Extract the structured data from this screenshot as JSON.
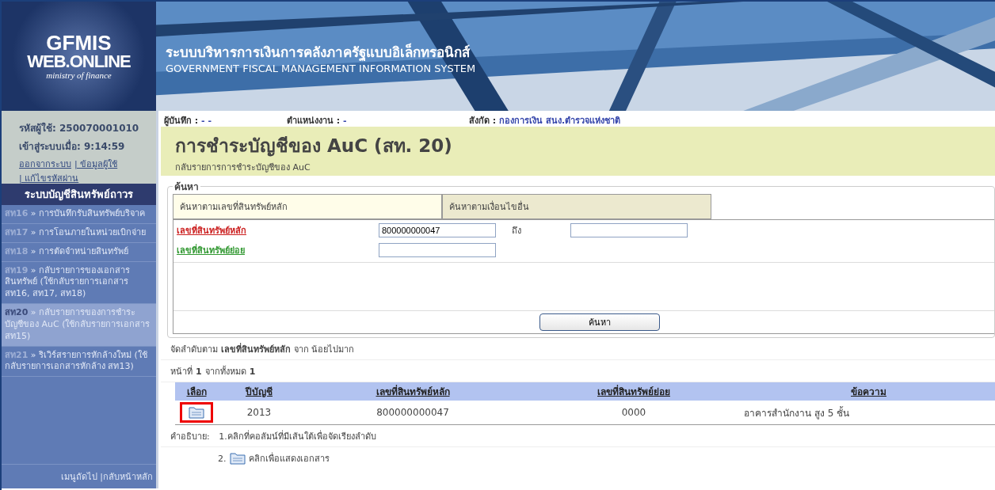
{
  "logo": {
    "line_1": "GFMIS",
    "line_2": "WEB.ONLINE",
    "line_3": "ministry of finance"
  },
  "banner": {
    "title_th": "ระบบบริหารการเงินการคลังภาครัฐแบบอิเล็กทรอนิกส์",
    "title_en": "GOVERNMENT FISCAL MANAGEMENT INFORMATION SYSTEM"
  },
  "user": {
    "id_label": "รหัสผู้ใช้:",
    "id_value": "250070001010",
    "login_label": "เข้าสู่ระบบเมื่อ:",
    "login_value": "9:14:59",
    "links": [
      "ออกจากระบบ",
      "| ข้อมูลผู้ใช้",
      "| แก้ไขรหัสผ่าน"
    ]
  },
  "sidebar": {
    "title": "ระบบบัญชีสินทรัพย์ถาวร",
    "items": [
      {
        "code": "สท16",
        "text": "» การบันทึกรับสินทรัพย์บริจาค",
        "selected": false
      },
      {
        "code": "สท17",
        "text": "» การโอนภายในหน่วยเบิกจ่าย",
        "selected": false
      },
      {
        "code": "สท18",
        "text": "» การตัดจำหน่ายสินทรัพย์",
        "selected": false
      },
      {
        "code": "สท19",
        "text": "» กลับรายการของเอกสารสินทรัพย์ (ใช้กลับรายการเอกสาร สท16, สท17, สท18)",
        "selected": false
      },
      {
        "code": "สท20",
        "text": "» กลับรายการของการชำระบัญชีของ AuC (ใช้กลับรายการเอกสาร สท15)",
        "selected": true
      },
      {
        "code": "สท21",
        "text": "» ริเวิร์สรายการหักล้างใหม่ (ใช้กลับรายการเอกสารหักล้าง สท13)",
        "selected": false
      }
    ],
    "footer": "เมนูถัดไป |กลับหน้าหลัก"
  },
  "info": [
    {
      "label": "ผู้บันทึก :",
      "value": "- -"
    },
    {
      "label": "ตำแหน่งงาน :",
      "value": "-"
    },
    {
      "label": "สังกัด :",
      "value": "กองการเงิน สนง.ตำรวจแห่งชาติ"
    }
  ],
  "page": {
    "title": "การชำระบัญชีของ AuC (สท. 20)",
    "subtitle": "กลับรายการการชำระบัญชีของ AuC"
  },
  "search": {
    "legend": "ค้นหา",
    "tabs": [
      {
        "label": "ค้นหาตามเลขที่สินทรัพย์หลัก",
        "selected": true
      },
      {
        "label": "ค้นหาตามเงื่อนไขอื่น",
        "selected": false
      }
    ],
    "main_label": "เลขที่สินทรัพย์หลัก",
    "main_value": "800000000047",
    "to_label": "ถึง",
    "sub_label": "เลขที่สินทรัพย์ย่อย",
    "button": "ค้นหา"
  },
  "sort_text": "จัดลำดับตาม **เลขที่สินทรัพย์หลัก** จาก น้อยไปมาก",
  "page_text": "หน้าที่ **1** จากทั้งหมด **1**",
  "table": {
    "columns": [
      "เลือก",
      "ปีบัญชี",
      "เลขที่สินทรัพย์หลัก",
      "เลขที่สินทรัพย์ย่อย",
      "ข้อความ"
    ],
    "rows": [
      {
        "year": "2013",
        "main": "800000000047",
        "sub": "0000",
        "text": "อาคารสำนักงาน สูง 5 ชั้น",
        "highlighted": true
      }
    ]
  },
  "notes": {
    "label": "คำอธิบาย:",
    "item_1": "1.คลิกที่คอลัมน์ที่มีเส้นใต้เพื่อจัดเรียงลำดับ",
    "item_2_num": "2.",
    "item_2_text": "คลิกเพื่อแสดงเอกสาร"
  }
}
